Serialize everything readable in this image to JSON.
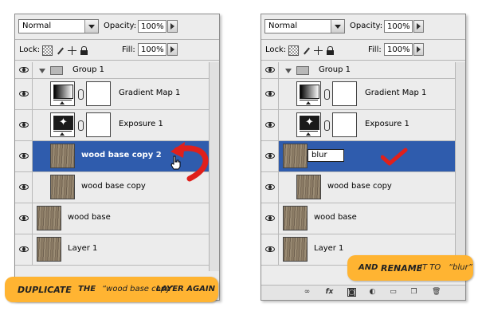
{
  "colors": {
    "selection": "#2f5cad",
    "banner": "#ffb432",
    "arrow": "#e0201b",
    "check": "#e0201b"
  },
  "left_panel": {
    "blend_mode": "Normal",
    "opacity_label": "Opacity:",
    "opacity_value": "100%",
    "lock_label": "Lock:",
    "fill_label": "Fill:",
    "fill_value": "100%",
    "group_name": "Group 1",
    "layers": [
      {
        "name": "Gradient Map 1",
        "type": "adjustment",
        "icon": "gradient-map-icon"
      },
      {
        "name": "Exposure 1",
        "type": "adjustment",
        "icon": "exposure-icon"
      },
      {
        "name": "wood base copy 2",
        "type": "image",
        "selected": true
      },
      {
        "name": "wood base copy",
        "type": "image"
      },
      {
        "name": "wood base",
        "type": "image"
      },
      {
        "name": "Layer 1",
        "type": "image"
      }
    ]
  },
  "right_panel": {
    "blend_mode": "Normal",
    "opacity_label": "Opacity:",
    "opacity_value": "100%",
    "lock_label": "Lock:",
    "fill_label": "Fill:",
    "fill_value": "100%",
    "group_name": "Group 1",
    "rename_value": "blur",
    "layers": [
      {
        "name": "Gradient Map 1",
        "type": "adjustment",
        "icon": "gradient-map-icon"
      },
      {
        "name": "Exposure 1",
        "type": "adjustment",
        "icon": "exposure-icon"
      },
      {
        "name": "",
        "type": "image",
        "selected": true,
        "editing": true
      },
      {
        "name": "wood base copy",
        "type": "image"
      },
      {
        "name": "wood base",
        "type": "image"
      },
      {
        "name": "Layer 1",
        "type": "image"
      }
    ]
  },
  "banner_left": {
    "word1": "DUPLICATE",
    "word2": " THE ",
    "word3": "“wood base copy”",
    "word4": " LAYER AGAIN"
  },
  "banner_right": {
    "word1": "AND ",
    "word2": "RENAME",
    "word3": " IT TO ",
    "word4": "“blur”"
  },
  "bottom_icons": [
    "link-icon",
    "fx-icon",
    "mask-icon",
    "adjustment-icon",
    "folder-icon",
    "new-layer-icon",
    "trash-icon"
  ]
}
